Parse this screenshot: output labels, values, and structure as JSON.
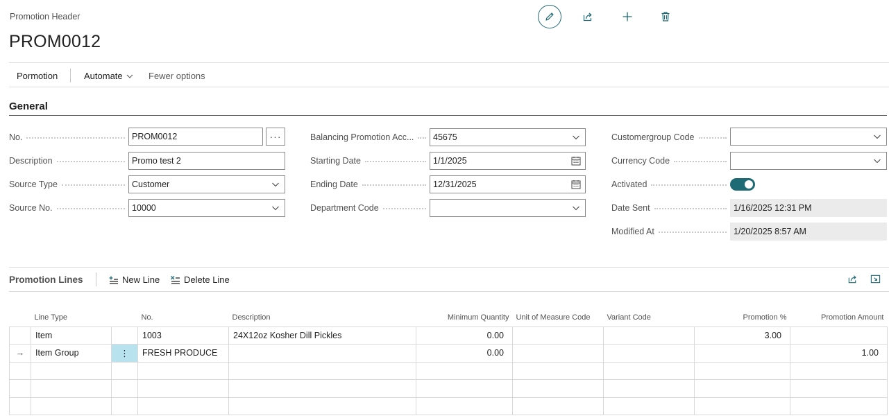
{
  "header": {
    "caption": "Promotion Header",
    "title": "PROM0012"
  },
  "actions": {
    "pormotion": "Pormotion",
    "automate": "Automate",
    "fewer": "Fewer options"
  },
  "general": {
    "title": "General",
    "col1": {
      "no_label": "No.",
      "no_value": "PROM0012",
      "assist_label": "···",
      "description_label": "Description",
      "description_value": "Promo test 2",
      "source_type_label": "Source Type",
      "source_type_value": "Customer",
      "source_no_label": "Source No.",
      "source_no_value": "10000"
    },
    "col2": {
      "balancing_label": "Balancing Promotion Acc...",
      "balancing_value": "45675",
      "starting_label": "Starting Date",
      "starting_value": "1/1/2025",
      "ending_label": "Ending Date",
      "ending_value": "12/31/2025",
      "department_label": "Department Code",
      "department_value": ""
    },
    "col3": {
      "customergroup_label": "Customergroup Code",
      "customergroup_value": "",
      "currency_label": "Currency Code",
      "currency_value": "",
      "activated_label": "Activated",
      "activated": true,
      "date_sent_label": "Date Sent",
      "date_sent_value": "1/16/2025 12:31 PM",
      "modified_label": "Modified At",
      "modified_value": "1/20/2025 8:57 AM"
    }
  },
  "lines": {
    "title": "Promotion Lines",
    "new_line": "New Line",
    "delete_line": "Delete Line",
    "columns": {
      "line_type": "Line Type",
      "no": "No.",
      "description": "Description",
      "min_qty": "Minimum Quantity",
      "uom": "Unit of Measure Code",
      "variant": "Variant Code",
      "promo_pct": "Promotion %",
      "promo_amt": "Promotion Amount"
    },
    "rows": [
      {
        "arrow": "",
        "line_type": "Item",
        "menu": "",
        "no": "1003",
        "description": "24X12oz Kosher Dill Pickles",
        "min_qty": "0.00",
        "uom": "",
        "variant": "",
        "promo_pct": "3.00",
        "promo_amt": ""
      },
      {
        "arrow": "→",
        "line_type": "Item Group",
        "menu": "⋮",
        "no": "FRESH PRODUCE",
        "description": "",
        "min_qty": "0.00",
        "uom": "",
        "variant": "",
        "promo_pct": "",
        "promo_amt": "1.00"
      }
    ]
  },
  "colors": {
    "accent": "#1f6b75",
    "selected_cell": "#b7e2ee",
    "readonly_bg": "#ebebeb"
  }
}
